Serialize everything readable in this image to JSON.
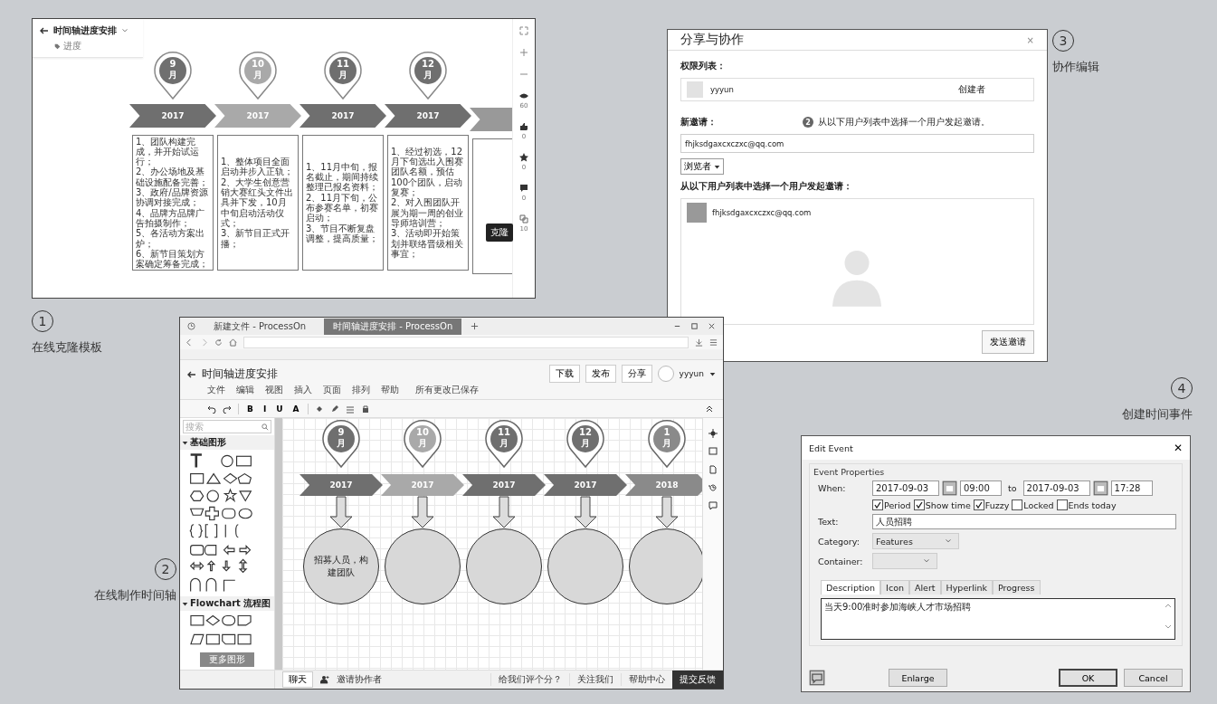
{
  "template_preview": {
    "title": "时间轴进度安排",
    "tag": "进度",
    "tooltip": "克隆",
    "stats": [
      {
        "kind": "eye",
        "count": "60"
      },
      {
        "kind": "like",
        "count": "0"
      },
      {
        "kind": "star",
        "count": "0"
      },
      {
        "kind": "comment",
        "count": "0"
      },
      {
        "kind": "clone",
        "count": "10"
      }
    ],
    "milestones": [
      {
        "number": "9",
        "unit": "月",
        "year": "2017",
        "color": "#6f6f6f",
        "items": [
          "1、团队构建完成，并开始试运行；",
          "2、办公场地及基础设施配备完善；",
          "3、政府/品牌资源协调对接完成；",
          "4、品牌方品牌广告拍摄制作；",
          "5、各活动方案出炉；",
          "6、新节目策划方案确定筹备完成；"
        ]
      },
      {
        "number": "10",
        "unit": "月",
        "year": "2017",
        "color": "#a9a9a9",
        "items": [
          "1、整体项目全面启动并步入正轨；",
          "2、大学生创意营销大赛红头文件出具并下发，10月中旬启动活动仪式；",
          "3、新节目正式开播；"
        ]
      },
      {
        "number": "11",
        "unit": "月",
        "year": "2017",
        "color": "#6f6f6f",
        "items": [
          "1、11月中旬，报名截止，期间持续整理已报名资料；",
          "2、11月下旬，公布参赛名单，初赛启动；",
          "3、节目不断复盘调整，提高质量；"
        ]
      },
      {
        "number": "12",
        "unit": "月",
        "year": "2017",
        "color": "#6f6f6f",
        "items": [
          "1、经过初选，12月下旬选出入围赛团队名额，预估100个团队，启动复赛；",
          "2、对入围团队开展为期一周的创业导师培训营；",
          "3、活动即开始策划并联络晋级相关事宜；"
        ]
      }
    ]
  },
  "share_dialog": {
    "title": "分享与协作",
    "close": "×",
    "permissions_label": "权限列表：",
    "owner": {
      "name": "yyyun",
      "role": "创建者"
    },
    "invite_label": "新邀请：",
    "hint_number": "2",
    "hint": "从以下用户列表中选择一个用户发起邀请。",
    "invite_value": "fhjksdgaxcxczxc@qq.com",
    "role_select": "浏览者",
    "pick_label": "从以下用户列表中选择一个用户发起邀请：",
    "users": [
      "fhjksdgaxcxczxc@qq.com"
    ],
    "send": "发送邀请"
  },
  "editor": {
    "browser_tabs": [
      {
        "label": "新建文件 - ProcessOn",
        "selected": false
      },
      {
        "label": "时间轴进度安排 - ProcessOn",
        "selected": true
      }
    ],
    "title": "时间轴进度安排",
    "menu": [
      "文件",
      "编辑",
      "视图",
      "插入",
      "页面",
      "排列",
      "帮助"
    ],
    "save_status": "所有更改已保存",
    "actions": [
      "下载",
      "发布",
      "分享"
    ],
    "user": "yyyun",
    "format_buttons": [
      "B",
      "I",
      "U",
      "A"
    ],
    "search_placeholder": "搜索",
    "palette_sections": [
      "基础图形",
      "Flowchart 流程图"
    ],
    "more_shapes": "更多图形",
    "milestones": [
      {
        "number": "9",
        "unit": "月",
        "year": "2017",
        "color": "#6f6f6f",
        "text": "招募人员，构建团队"
      },
      {
        "number": "10",
        "unit": "月",
        "year": "2017",
        "color": "#a9a9a9"
      },
      {
        "number": "11",
        "unit": "月",
        "year": "2017",
        "color": "#6f6f6f"
      },
      {
        "number": "12",
        "unit": "月",
        "year": "2017",
        "color": "#6f6f6f"
      },
      {
        "number": "1",
        "unit": "月",
        "year": "2018",
        "color": "#8a8a8a"
      }
    ],
    "footer": {
      "chat": "聊天",
      "invite": "邀请协作者",
      "rate": "给我们评个分？",
      "follow": "关注我们",
      "help": "帮助中心",
      "feedback": "提交反馈"
    }
  },
  "event_dialog": {
    "title": "Edit Event",
    "close": "✕",
    "group": "Event Properties",
    "when_label": "When:",
    "start_date": "2017-09-03",
    "start_time": "09:00",
    "to": "to",
    "end_date": "2017-09-03",
    "end_time": "17:28",
    "options": [
      {
        "label": "Period",
        "checked": true
      },
      {
        "label": "Show time",
        "checked": true
      },
      {
        "label": "Fuzzy",
        "checked": true
      },
      {
        "label": "Locked",
        "checked": false
      },
      {
        "label": "Ends today",
        "checked": false
      }
    ],
    "text_label": "Text:",
    "text_value": "人员招聘",
    "category_label": "Category:",
    "category": "Features",
    "container_label": "Container:",
    "tabs": [
      {
        "label": "Description",
        "selected": true
      },
      {
        "label": "Icon",
        "selected": false
      },
      {
        "label": "Alert",
        "selected": false
      },
      {
        "label": "Hyperlink",
        "selected": false
      },
      {
        "label": "Progress",
        "selected": false
      }
    ],
    "description": "当天9:00准时参加海峡人才市场招聘",
    "buttons": [
      {
        "label": "Enlarge",
        "default": false
      },
      {
        "label": "OK",
        "default": true
      },
      {
        "label": "Cancel",
        "default": false
      }
    ]
  },
  "captions": [
    {
      "number": "1",
      "text": "在线克隆模板"
    },
    {
      "number": "2",
      "text": "在线制作时间轴"
    },
    {
      "number": "3",
      "text": "协作编辑"
    },
    {
      "number": "4",
      "text": "创建时间事件"
    }
  ]
}
